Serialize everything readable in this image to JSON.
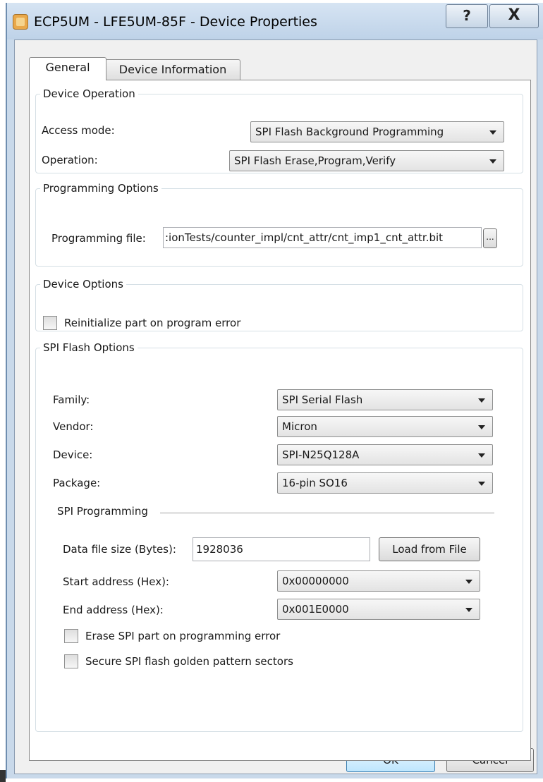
{
  "window": {
    "title": "ECP5UM - LFE5UM-85F - Device Properties",
    "help_label": "?",
    "close_label": "X"
  },
  "tabs": [
    {
      "label": "General"
    },
    {
      "label": "Device Information"
    }
  ],
  "device_operation": {
    "legend": "Device Operation",
    "access_mode_label": "Access mode:",
    "access_mode_value": "SPI Flash Background Programming",
    "operation_label": "Operation:",
    "operation_value": "SPI Flash Erase,Program,Verify"
  },
  "programming_options": {
    "legend": "Programming Options",
    "file_label": "Programming file:",
    "file_value": ":ionTests/counter_impl/cnt_attr/cnt_imp1_cnt_attr.bit",
    "browse_label": "..."
  },
  "device_options": {
    "legend": "Device Options",
    "reinitialize_label": "Reinitialize part on program error",
    "reinitialize_checked": false
  },
  "spi_flash_options": {
    "legend": "SPI Flash Options",
    "family_label": "Family:",
    "family_value": "SPI Serial Flash",
    "vendor_label": "Vendor:",
    "vendor_value": "Micron",
    "device_label": "Device:",
    "device_value": "SPI-N25Q128A",
    "package_label": "Package:",
    "package_value": "16-pin SO16",
    "spi_programming": {
      "heading": "SPI Programming",
      "data_size_label": "Data file size (Bytes):",
      "data_size_value": "1928036",
      "load_button": "Load from File",
      "start_label": "Start address (Hex):",
      "start_value": "0x00000000",
      "end_label": "End address (Hex):",
      "end_value": "0x001E0000",
      "erase_label": "Erase SPI part on programming error",
      "erase_checked": false,
      "secure_label": "Secure SPI flash golden pattern sectors",
      "secure_checked": false
    }
  },
  "buttons": {
    "ok": "OK",
    "cancel": "Cancel"
  }
}
